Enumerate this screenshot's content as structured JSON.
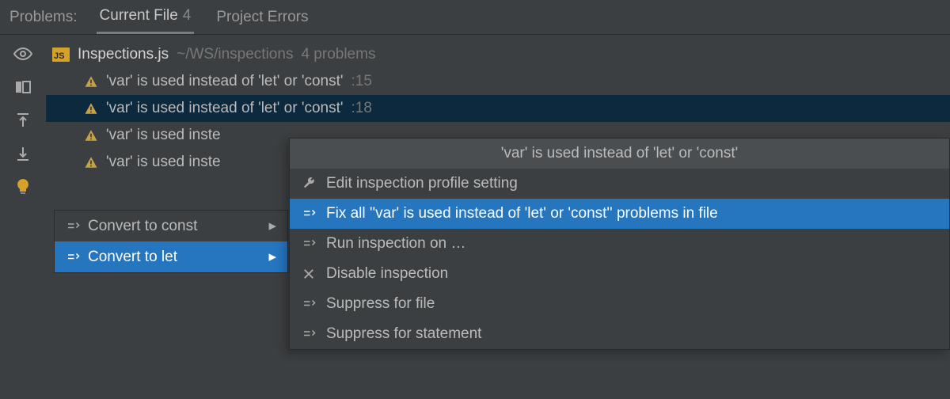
{
  "tabs": {
    "label": "Problems:",
    "current_file": "Current File",
    "current_file_count": "4",
    "project_errors": "Project Errors"
  },
  "file": {
    "name": "Inspections.js",
    "path": "~/WS/inspections",
    "count": "4 problems"
  },
  "problems": [
    {
      "text": "'var' is used instead of 'let' or 'const'",
      "line": ":15"
    },
    {
      "text": "'var' is used instead of 'let' or 'const'",
      "line": ":18"
    },
    {
      "text": "'var' is used inste",
      "line": ""
    },
    {
      "text": "'var' is used inste",
      "line": ""
    }
  ],
  "quickfix": {
    "item0": "Convert to const",
    "item1": "Convert to let"
  },
  "popup": {
    "header": "'var' is used instead of 'let' or 'const'",
    "edit": "Edit inspection profile setting",
    "fixall": "Fix all ''var' is used instead of 'let' or 'const'' problems in file",
    "run": "Run inspection on …",
    "disable": "Disable inspection",
    "suppress_file": "Suppress for file",
    "suppress_stmt": "Suppress for statement"
  }
}
